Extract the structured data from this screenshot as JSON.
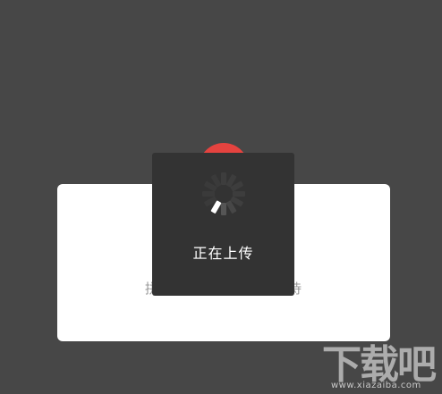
{
  "background_color": "#474747",
  "avatar": {
    "icon": "red-circle-avatar",
    "color": "#e5433f"
  },
  "dialog": {
    "title": "正在上传",
    "subtitle": "拼图上传中，请耐心等待"
  },
  "toast": {
    "label": "正在上传",
    "icon": "loading-spinner-icon"
  },
  "watermark": {
    "brand": "下载吧",
    "url": "www.xiazaiba.com"
  }
}
